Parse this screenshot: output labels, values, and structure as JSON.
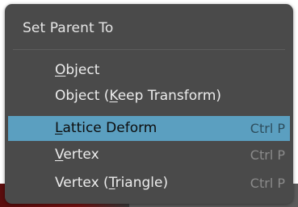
{
  "menu": {
    "title": "Set Parent To",
    "items": [
      {
        "pre": "",
        "ul": "O",
        "post": "bject",
        "shortcut": "",
        "highlighted": false
      },
      {
        "pre": "Object (",
        "ul": "K",
        "post": "eep Transform)",
        "shortcut": "",
        "highlighted": false
      },
      {
        "pre": "",
        "ul": "L",
        "post": "attice Deform",
        "shortcut": "Ctrl P",
        "highlighted": true
      },
      {
        "pre": "",
        "ul": "V",
        "post": "ertex",
        "shortcut": "Ctrl P",
        "highlighted": false
      },
      {
        "pre": "Vertex (",
        "ul": "T",
        "post": "riangle)",
        "shortcut": "Ctrl P",
        "highlighted": false
      }
    ]
  },
  "colors": {
    "menu_bg": "#4a4a4a",
    "highlight": "#5b9fc0",
    "text": "#ececec",
    "shortcut": "#8a8a8a"
  }
}
